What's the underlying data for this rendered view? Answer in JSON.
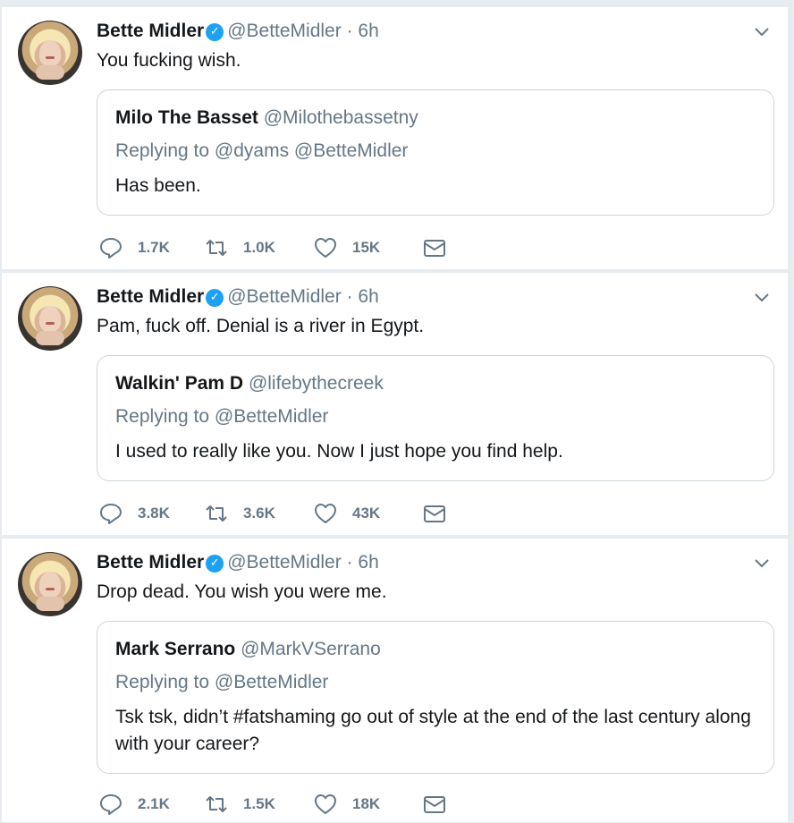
{
  "tweets": [
    {
      "author": {
        "name": "Bette Midler",
        "handle": "@BetteMidler",
        "time": "6h"
      },
      "text": "You fucking wish.",
      "quote": {
        "name": "Milo The Basset",
        "handle": "@Milothebassetny",
        "replying": "Replying to @dyams @BetteMidler",
        "text": "Has been."
      },
      "stats": {
        "replies": "1.7K",
        "retweets": "1.0K",
        "likes": "15K"
      }
    },
    {
      "author": {
        "name": "Bette Midler",
        "handle": "@BetteMidler",
        "time": "6h"
      },
      "text": "Pam, fuck off.  Denial is a river in Egypt.",
      "quote": {
        "name": "Walkin' Pam D",
        "handle": "@lifebythecreek",
        "replying": "Replying to @BetteMidler",
        "text": "I used to really like you. Now I just hope you find help."
      },
      "stats": {
        "replies": "3.8K",
        "retweets": "3.6K",
        "likes": "43K"
      }
    },
    {
      "author": {
        "name": "Bette Midler",
        "handle": "@BetteMidler",
        "time": "6h"
      },
      "text": "Drop dead.  You wish you were me.",
      "quote": {
        "name": "Mark Serrano",
        "handle": "@MarkVSerrano",
        "replying": "Replying to @BetteMidler",
        "text": "Tsk tsk, didn’t #fatshaming go out of style at the end of the last century along with your career?"
      },
      "stats": {
        "replies": "2.1K",
        "retweets": "1.5K",
        "likes": "18K"
      }
    }
  ],
  "symbols": {
    "verified": "✓",
    "dot": "·"
  },
  "icons": {
    "verified": "verified-badge-icon",
    "caret": "chevron-down-icon",
    "reply": "reply-icon",
    "retweet": "retweet-icon",
    "like": "heart-icon",
    "dm": "envelope-icon"
  },
  "colors": {
    "accent": "#1da1f2",
    "secondary_text": "#657786",
    "border": "#ccd6dd",
    "background": "#e6ecf0"
  }
}
